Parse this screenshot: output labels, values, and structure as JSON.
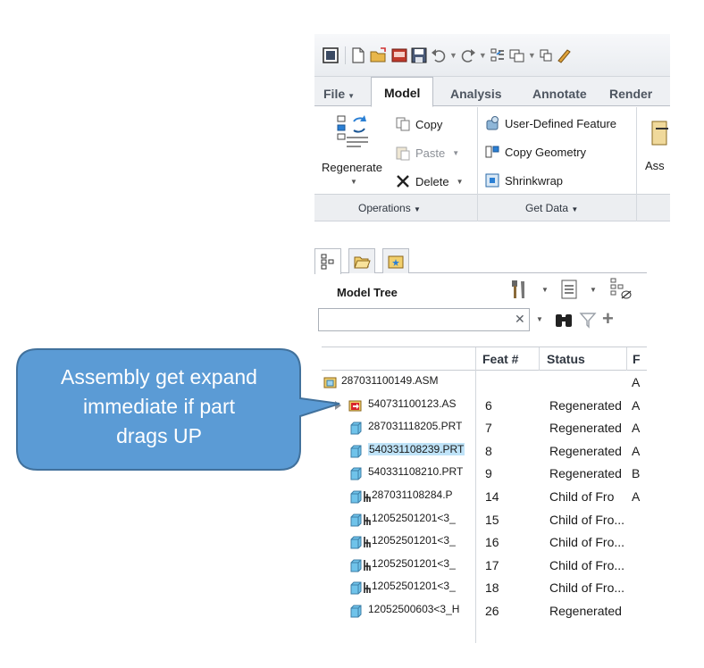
{
  "ribbon_tabs": [
    {
      "label": "File",
      "has_dropdown": true
    },
    {
      "label": "Model",
      "active": true
    },
    {
      "label": "Analysis"
    },
    {
      "label": "Annotate"
    },
    {
      "label": "Render"
    }
  ],
  "operations": {
    "regenerate": "Regenerate",
    "copy": "Copy",
    "paste": "Paste",
    "delete": "Delete",
    "group_label": "Operations"
  },
  "get_data": {
    "user_defined_feature": "User-Defined Feature",
    "copy_geometry": "Copy Geometry",
    "shrinkwrap": "Shrinkwrap",
    "group_label": "Get Data"
  },
  "assemble_partial": "Ass",
  "model_tree": {
    "title": "Model Tree",
    "search_value": "",
    "columns": [
      "Feat #",
      "Status",
      "F"
    ],
    "rows": [
      {
        "name": "287031100149.ASM",
        "feat": "",
        "status": "",
        "extra": "A",
        "type": "assembly-root"
      },
      {
        "name": "540731100123.AS",
        "feat": "6",
        "status": "Regenerated",
        "extra": "A",
        "type": "assembly-dragged",
        "collapsed": true
      },
      {
        "name": "287031118205.PRT",
        "feat": "7",
        "status": "Regenerated",
        "extra": "A",
        "type": "part"
      },
      {
        "name": "540331108239.PRT",
        "feat": "8",
        "status": "Regenerated",
        "extra": "A",
        "type": "part",
        "selected": true
      },
      {
        "name": "540331108210.PRT",
        "feat": "9",
        "status": "Regenerated",
        "extra": "B",
        "type": "part"
      },
      {
        "name": "287031108284.P",
        "feat": "14",
        "status": "Child of Fro",
        "extra": "A",
        "type": "part-child"
      },
      {
        "name": "12052501201<3_",
        "feat": "15",
        "status": "Child of Fro...",
        "extra": "",
        "type": "part-child"
      },
      {
        "name": "12052501201<3_",
        "feat": "16",
        "status": "Child of Fro...",
        "extra": "",
        "type": "part-child"
      },
      {
        "name": "12052501201<3_",
        "feat": "17",
        "status": "Child of Fro...",
        "extra": "",
        "type": "part-child"
      },
      {
        "name": "12052501201<3_",
        "feat": "18",
        "status": "Child of Fro...",
        "extra": "",
        "type": "part-child"
      },
      {
        "name": "12052500603<3_H",
        "feat": "26",
        "status": "Regenerated",
        "extra": "",
        "type": "part"
      }
    ]
  },
  "callout": {
    "text_lines": [
      "Assembly get expand",
      "immediate if part",
      "drags UP"
    ]
  },
  "colors": {
    "callout_fill": "#5b9bd5",
    "callout_border": "#41719c",
    "selection": "#bfe3f8",
    "part_icon": "#6fc3ea",
    "dragged_icon": "#d9262c"
  }
}
